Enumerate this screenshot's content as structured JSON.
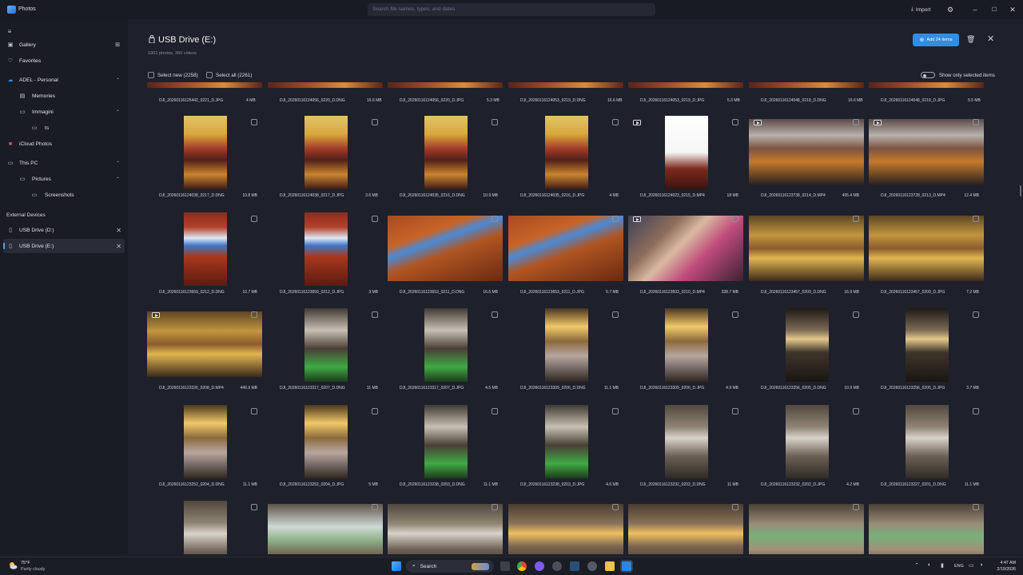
{
  "app": {
    "title": "Photos",
    "search_placeholder": "Search file names, types, and dates",
    "import_label": "Import"
  },
  "sidebar": {
    "items": [
      {
        "label": "Gallery",
        "icon": "image-icon"
      },
      {
        "label": "Favorites",
        "icon": "heart-icon"
      },
      {
        "label": "ADEL - Personal",
        "icon": "cloud-icon"
      },
      {
        "label": "Memories",
        "icon": "memories-icon"
      },
      {
        "label": "Immagini",
        "icon": "folder-icon"
      },
      {
        "label": "ts",
        "icon": "folder-icon"
      },
      {
        "label": "iCloud Photos",
        "icon": "icloud-icon"
      },
      {
        "label": "This PC",
        "icon": "pc-icon"
      },
      {
        "label": "Pictures",
        "icon": "folder-icon"
      },
      {
        "label": "Screenshots",
        "icon": "folder-icon"
      }
    ],
    "external_header": "External Devices",
    "devices": [
      {
        "label": "USB Drive (D:)",
        "active": false
      },
      {
        "label": "USB Drive (E:)",
        "active": true
      }
    ]
  },
  "header": {
    "title": "USB Drive (E:)",
    "subtitle": "1901 photos, 360 videos",
    "add_button": "Add 24 items",
    "select_new": "Select new (2258)",
    "select_all": "Select all (2261)",
    "show_selected": "Show only selected items"
  },
  "grid": {
    "top_row": [
      {
        "name": "DJI_20260116125442_0221_D.JPG",
        "size": "4 MB"
      },
      {
        "name": "DJI_20260116124056_0220_D.DNG",
        "size": "16.6 MB"
      },
      {
        "name": "DJI_20260116124056_0220_D.JPG",
        "size": "5.3 MB"
      },
      {
        "name": "DJI_20260116124053_0219_D.DNG",
        "size": "16.6 MB"
      },
      {
        "name": "DJI_20260116124053_0219_D.JPG",
        "size": "5.3 MB"
      },
      {
        "name": "DJI_20260116124048_0218_D.DNG",
        "size": "16.6 MB"
      },
      {
        "name": "DJI_20260116124048_0218_D.JPG",
        "size": "5.5 MB"
      }
    ],
    "rows": [
      [
        {
          "name": "DJI_20260116124038_0217_D.DNG",
          "size": "10.8 MB",
          "shape": "p",
          "scene": "bar",
          "video": false
        },
        {
          "name": "DJI_20260116124038_0217_D.JPG",
          "size": "3.6 MB",
          "shape": "p",
          "scene": "bar",
          "video": false
        },
        {
          "name": "DJI_20260116124035_0216_D.DNG",
          "size": "10.9 MB",
          "shape": "p",
          "scene": "bar",
          "video": false
        },
        {
          "name": "DJI_20260116124035_0216_D.JPG",
          "size": "4 MB",
          "shape": "p",
          "scene": "bar",
          "video": false
        },
        {
          "name": "DJI_20260116124023_0215_D.MP4",
          "size": "18 MB",
          "shape": "p",
          "scene": "white",
          "video": true
        },
        {
          "name": "DJI_20260116123738_0214_D.MP4",
          "size": "495.4 MB",
          "shape": "l",
          "scene": "barwide",
          "video": true
        },
        {
          "name": "DJI_20260116123728_0213_D.MP4",
          "size": "12.4 MB",
          "shape": "l",
          "scene": "barwide",
          "video": true
        }
      ],
      [
        {
          "name": "DJI_20260116123659_0212_D.DNG",
          "size": "10.7 MB",
          "shape": "p",
          "scene": "screen",
          "video": false
        },
        {
          "name": "DJI_20260116123659_0212_D.JPG",
          "size": "3 MB",
          "shape": "p",
          "scene": "screen",
          "video": false
        },
        {
          "name": "DJI_20260116123653_0211_D.DNG",
          "size": "16.6 MB",
          "shape": "l",
          "scene": "wood",
          "video": false
        },
        {
          "name": "DJI_20260116123653_0211_D.JPG",
          "size": "5.7 MB",
          "shape": "l",
          "scene": "wood",
          "video": false
        },
        {
          "name": "DJI_20260116123503_0210_D.MP4",
          "size": "338.7 MB",
          "shape": "l",
          "scene": "shop",
          "video": true
        },
        {
          "name": "DJI_20260116123457_0209_D.DNG",
          "size": "16.9 MB",
          "shape": "l",
          "scene": "room",
          "video": false
        },
        {
          "name": "DJI_20260116123457_0209_D.JPG",
          "size": "7.2 MB",
          "shape": "l",
          "scene": "room",
          "video": false
        }
      ],
      [
        {
          "name": "DJI_20260116123326_0208_D.MP4",
          "size": "440.9 MB",
          "shape": "l",
          "scene": "room",
          "video": true
        },
        {
          "name": "DJI_20260116123317_0207_D.DNG",
          "size": "11 MB",
          "shape": "p",
          "scene": "green",
          "video": false
        },
        {
          "name": "DJI_20260116123317_0207_D.JPG",
          "size": "4.5 MB",
          "shape": "p",
          "scene": "green",
          "video": false
        },
        {
          "name": "DJI_20260116123309_0206_D.DNG",
          "size": "11.1 MB",
          "shape": "p",
          "scene": "chand",
          "video": false
        },
        {
          "name": "DJI_20260116123309_0206_D.JPG",
          "size": "4.9 MB",
          "shape": "p",
          "scene": "chand",
          "video": false
        },
        {
          "name": "DJI_20260116123256_0205_D.DNG",
          "size": "10.9 MB",
          "shape": "p",
          "scene": "dark",
          "video": false
        },
        {
          "name": "DJI_20260116123256_0205_D.JPG",
          "size": "3.7 MB",
          "shape": "p",
          "scene": "dark",
          "video": false
        }
      ],
      [
        {
          "name": "DJI_20260116123252_0204_D.DNG",
          "size": "11.1 MB",
          "shape": "p",
          "scene": "chand",
          "video": false
        },
        {
          "name": "DJI_20260116123252_0204_D.JPG",
          "size": "5 MB",
          "shape": "p",
          "scene": "chand",
          "video": false
        },
        {
          "name": "DJI_20260116123238_0203_D.DNG",
          "size": "11.1 MB",
          "shape": "p",
          "scene": "green",
          "video": false
        },
        {
          "name": "DJI_20260116123238_0203_D.JPG",
          "size": "4.6 MB",
          "shape": "p",
          "scene": "green",
          "video": false
        },
        {
          "name": "DJI_20260116123232_0202_D.DNG",
          "size": "11 MB",
          "shape": "p",
          "scene": "stone",
          "video": false
        },
        {
          "name": "DJI_20260116123232_0202_D.JPG",
          "size": "4.2 MB",
          "shape": "p",
          "scene": "stone",
          "video": false
        },
        {
          "name": "DJI_20260116123227_0201_D.DNG",
          "size": "11.1 MB",
          "shape": "p",
          "scene": "stone",
          "video": false
        }
      ],
      [
        {
          "name": "",
          "size": "",
          "shape": "p",
          "scene": "stone",
          "video": false
        },
        {
          "name": "",
          "size": "",
          "shape": "l",
          "scene": "window",
          "video": false
        },
        {
          "name": "",
          "size": "",
          "shape": "l",
          "scene": "stone",
          "video": false
        },
        {
          "name": "",
          "size": "",
          "shape": "l",
          "scene": "stonewarm",
          "video": false
        },
        {
          "name": "",
          "size": "",
          "shape": "l",
          "scene": "stonewarm",
          "video": false
        },
        {
          "name": "",
          "size": "",
          "shape": "l",
          "scene": "stonegreen",
          "video": false
        },
        {
          "name": "",
          "size": "",
          "shape": "l",
          "scene": "stonegreen",
          "video": false
        }
      ]
    ]
  },
  "taskbar": {
    "temperature": "75°F",
    "weather": "Partly cloudy",
    "search_label": "Search",
    "language": "ENG",
    "time": "4:47 AM",
    "date": "2/19/2026"
  },
  "colors": {
    "accent": "#2f8de4",
    "background": "#1e212c",
    "sidebar": "#1a1c23"
  }
}
